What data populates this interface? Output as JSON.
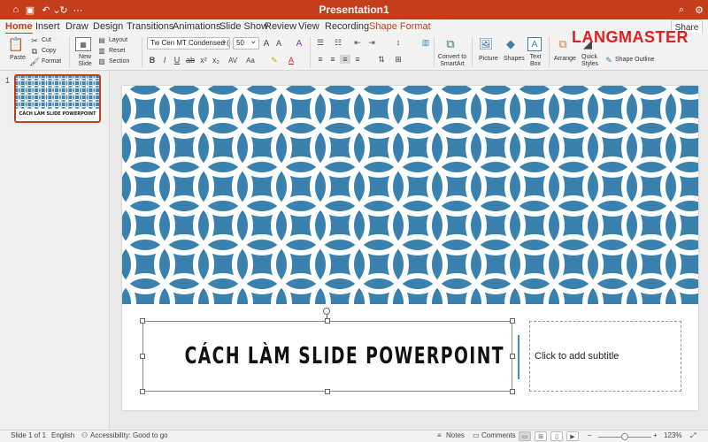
{
  "titlebar": {
    "document_title": "Presentation1",
    "quick_access": [
      "home-icon",
      "save-icon",
      "undo-icon",
      "redo-icon"
    ],
    "right_icons": [
      "search-icon",
      "settings-icon"
    ]
  },
  "tabs": [
    {
      "label": "Home"
    },
    {
      "label": "Insert"
    },
    {
      "label": "Draw"
    },
    {
      "label": "Design"
    },
    {
      "label": "Transitions"
    },
    {
      "label": "Animations"
    },
    {
      "label": "Slide Show"
    },
    {
      "label": "Review"
    },
    {
      "label": "View"
    },
    {
      "label": "Recording"
    },
    {
      "label": "Shape Format"
    }
  ],
  "share_label": "Share",
  "logo_text": "LANGMASTER",
  "ribbon": {
    "paste": "Paste",
    "cut": "Cut",
    "copy": "Copy",
    "format": "Format",
    "new_slide": "New Slide",
    "layout": "Layout",
    "reset": "Reset",
    "section": "Section",
    "font_name": "Tw Cen MT Condensed (...",
    "font_size": "50",
    "bold": "B",
    "italic": "I",
    "underline": "U",
    "convert_smartart": "Convert to SmartArt",
    "picture": "Picture",
    "shapes": "Shapes",
    "text_box": "Text Box",
    "arrange": "Arrange",
    "quick_styles": "Quick Styles",
    "shape_outline": "Shape Outline"
  },
  "thumbnail": {
    "number": "1",
    "title": "CÁCH LÀM SLIDE POWERPOINT"
  },
  "slide": {
    "title": "CÁCH LÀM SLIDE POWERPOINT",
    "subtitle_placeholder": "Click to add subtitle",
    "pattern_color": "#3a82ad"
  },
  "statusbar": {
    "slide_info": "Slide 1 of 1",
    "language": "English",
    "accessibility": "Accessibility: Good to go",
    "notes": "Notes",
    "comments": "Comments",
    "zoom": "123%"
  },
  "colors": {
    "accent": "#c43e1c",
    "logo": "#e02020"
  }
}
